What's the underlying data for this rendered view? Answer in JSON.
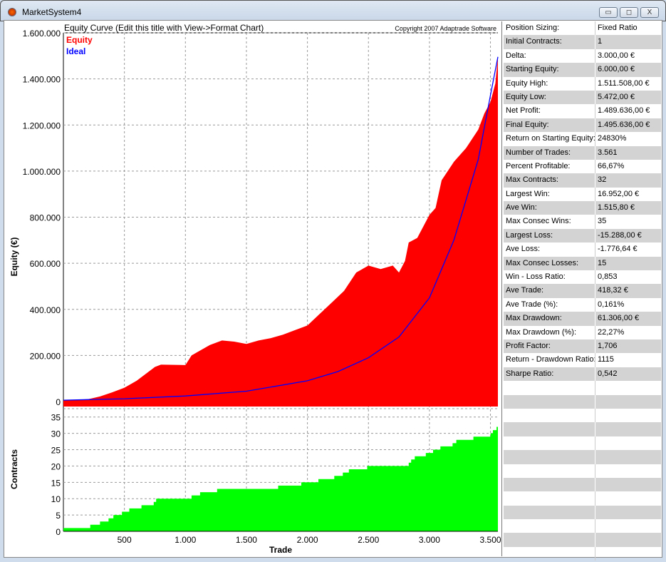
{
  "window": {
    "title": "MarketSystem4",
    "minimize": "▭",
    "maximize": "◻",
    "close": "X"
  },
  "chart_data": [
    {
      "type": "area",
      "title": "Equity Curve (Edit this title with View->Format Chart)",
      "copyright": "Copyright 2007 Adaptrade Software",
      "ylabel": "Equity (€)",
      "ylim": [
        0,
        1600000
      ],
      "yticks": [
        "0",
        "200.000",
        "400.000",
        "600.000",
        "800.000",
        "1.000.000",
        "1.200.000",
        "1.400.000",
        "1.600.000"
      ],
      "legend": [
        {
          "name": "Equity",
          "color": "#ff0000"
        },
        {
          "name": "Ideal",
          "color": "#0000ff"
        }
      ],
      "legend_position": "top-left",
      "series": [
        {
          "name": "Equity",
          "x": [
            0,
            200,
            300,
            400,
            500,
            600,
            700,
            750,
            800,
            1000,
            1050,
            1100,
            1200,
            1300,
            1400,
            1500,
            1600,
            1700,
            1800,
            1900,
            2000,
            2100,
            2200,
            2300,
            2400,
            2500,
            2600,
            2700,
            2750,
            2800,
            2830,
            2900,
            3000,
            3050,
            3100,
            3200,
            3300,
            3400,
            3450,
            3500,
            3540,
            3561
          ],
          "y": [
            6000,
            10000,
            22000,
            40000,
            60000,
            90000,
            130000,
            150000,
            160000,
            158000,
            200000,
            215000,
            245000,
            265000,
            260000,
            250000,
            265000,
            275000,
            290000,
            310000,
            330000,
            380000,
            430000,
            480000,
            560000,
            590000,
            575000,
            590000,
            560000,
            610000,
            690000,
            710000,
            810000,
            840000,
            960000,
            1040000,
            1100000,
            1180000,
            1250000,
            1300000,
            1380000,
            1495636
          ]
        },
        {
          "name": "Ideal",
          "x": [
            0,
            500,
            1000,
            1500,
            2000,
            2250,
            2500,
            2750,
            3000,
            3200,
            3400,
            3500,
            3561
          ],
          "y": [
            6000,
            12000,
            24000,
            45000,
            90000,
            130000,
            190000,
            280000,
            450000,
            700000,
            1050000,
            1330000,
            1495636
          ]
        }
      ]
    },
    {
      "type": "area",
      "ylabel": "Contracts",
      "xlabel": "Trade",
      "ylim": [
        0,
        38
      ],
      "xlim": [
        0,
        3561
      ],
      "yticks": [
        "0",
        "5",
        "10",
        "15",
        "20",
        "25",
        "30",
        "35"
      ],
      "xticks": [
        {
          "v": 500,
          "label": "500"
        },
        {
          "v": 1000,
          "label": "1.000"
        },
        {
          "v": 1500,
          "label": "1.500"
        },
        {
          "v": 2000,
          "label": "2.000"
        },
        {
          "v": 2500,
          "label": "2.500"
        },
        {
          "v": 3000,
          "label": "3.000"
        },
        {
          "v": 3500,
          "label": "3.500"
        }
      ],
      "series": [
        {
          "name": "Contracts",
          "color": "#00ff00",
          "x": [
            0,
            220,
            300,
            370,
            410,
            480,
            540,
            640,
            740,
            760,
            1050,
            1120,
            1260,
            1760,
            1950,
            2090,
            2220,
            2290,
            2340,
            2490,
            2830,
            2850,
            2880,
            2970,
            3030,
            3090,
            3190,
            3220,
            3360,
            3500,
            3520,
            3550
          ],
          "y": [
            1,
            2,
            3,
            4,
            5,
            6,
            7,
            8,
            9,
            10,
            11,
            12,
            13,
            14,
            15,
            16,
            17,
            18,
            19,
            20,
            21,
            22,
            23,
            24,
            25,
            26,
            27,
            28,
            29,
            30,
            31,
            32
          ]
        }
      ]
    }
  ],
  "stats": [
    [
      "Position Sizing:",
      "Fixed Ratio"
    ],
    [
      "Initial Contracts:",
      "1"
    ],
    [
      "Delta:",
      "3.000,00 €"
    ],
    [
      "Starting Equity:",
      "6.000,00 €"
    ],
    [
      "Equity High:",
      "1.511.508,00 €"
    ],
    [
      "Equity Low:",
      "5.472,00 €"
    ],
    [
      "Net Profit:",
      "1.489.636,00 €"
    ],
    [
      "Final Equity:",
      "1.495.636,00 €"
    ],
    [
      "Return on Starting Equity:",
      "24830%"
    ],
    [
      "Number of Trades:",
      "3.561"
    ],
    [
      "Percent Profitable:",
      "66,67%"
    ],
    [
      "Max Contracts:",
      "32"
    ],
    [
      "Largest Win:",
      "16.952,00 €"
    ],
    [
      "Ave Win:",
      "1.515,80 €"
    ],
    [
      "Max Consec Wins:",
      "35"
    ],
    [
      "Largest Loss:",
      "-15.288,00 €"
    ],
    [
      "Ave Loss:",
      "-1.776,64 €"
    ],
    [
      "Max Consec Losses:",
      "15"
    ],
    [
      "Win - Loss Ratio:",
      "0,853"
    ],
    [
      "Ave Trade:",
      "418,32 €"
    ],
    [
      "Ave Trade (%):",
      "0,161%"
    ],
    [
      "Max Drawdown:",
      "61.306,00 €"
    ],
    [
      "Max Drawdown (%):",
      "22,27%"
    ],
    [
      "Profit Factor:",
      "1,706"
    ],
    [
      "Return - Drawdown Ratio:",
      "1115"
    ],
    [
      "Sharpe Ratio:",
      "0,542"
    ]
  ]
}
